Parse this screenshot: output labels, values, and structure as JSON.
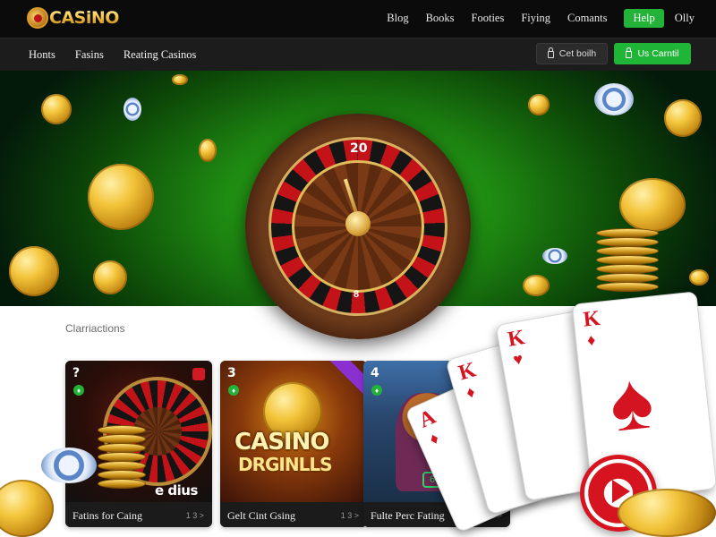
{
  "brand": {
    "logo_text": "CASiNO"
  },
  "top_nav": {
    "items": [
      "Blog",
      "Books",
      "Footies",
      "Fiying",
      "Comants"
    ],
    "help": "Help",
    "only": "Olly"
  },
  "sub_nav": {
    "items": [
      "Honts",
      "Fasins",
      "Reating Casinos"
    ],
    "login_label": "Cet boilh",
    "signup_label": "Us Carntil"
  },
  "hero": {
    "wheel_top_number": "20",
    "wheel_bottom_number": "8"
  },
  "section": {
    "title": "Clarriactions"
  },
  "cards": [
    {
      "number": "?",
      "tag": "♦",
      "label": "Fatins for Caing",
      "meta": "1 3 >",
      "art_text": "e dius"
    },
    {
      "number": "3",
      "tag": "♦",
      "label": "Gelt Cint Gsing",
      "meta": "1 3 >",
      "art_text_1": "CASINO",
      "art_text_2": "DRGINLLS"
    },
    {
      "number": "4",
      "tag": "♦",
      "label": "Fulte Perc Fating",
      "meta": "1 3 >",
      "art_icon": "6"
    }
  ],
  "playing_cards": [
    {
      "rank": "A",
      "suit": "♦"
    },
    {
      "rank": "K",
      "suit": "♦"
    },
    {
      "rank": "K",
      "suit": "♥"
    },
    {
      "rank": "K",
      "suit": "♦",
      "pip": "♠"
    }
  ],
  "colors": {
    "accent_green": "#22b338",
    "dark_bar": "#0b0b0b",
    "sub_bar": "#1c1c1c",
    "roulette_red": "#c41219",
    "gold": "#f3c43a"
  }
}
